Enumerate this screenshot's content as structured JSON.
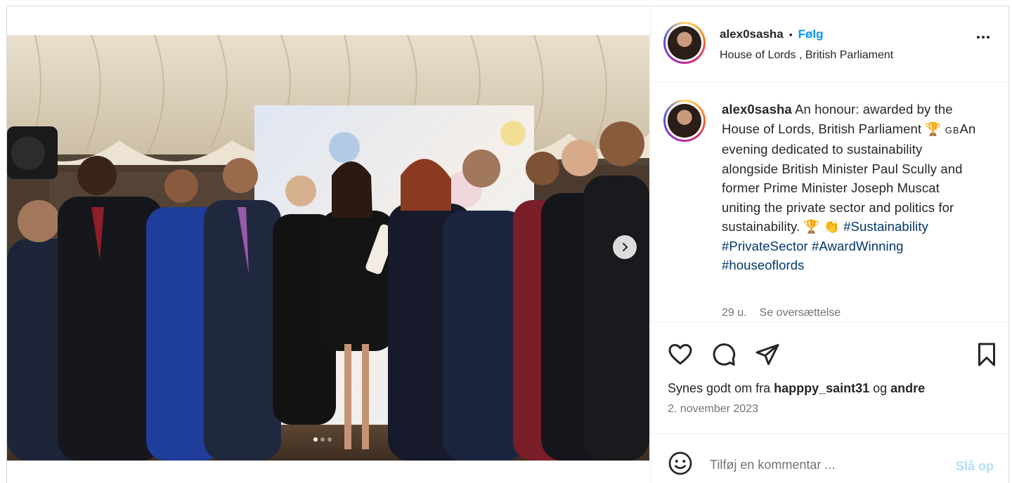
{
  "post": {
    "username": "alex0sasha",
    "follow_label": "Følg",
    "separator": "•",
    "location": "House of Lords , British Parliament",
    "caption_parts": {
      "text1": "An honour: awarded by the House of Lords, British Parliament 🏆 ",
      "flag": "GB",
      "text2": "An evening dedicated to sustainability alongside British Minister Paul Scully and former Prime Minister Joseph Muscat uniting the private sector and politics for sustainability. 🏆 👏 ",
      "hashtags": [
        "#Sustainability",
        "#PrivateSector",
        "#AwardWinning",
        "#houseoflords"
      ]
    },
    "time_ago": "29 u.",
    "translate_label": "Se oversættelse",
    "likes_prefix": "Synes godt om fra ",
    "likes_user": "happpy_saint31",
    "likes_middle": " og ",
    "likes_others": "andre",
    "date": "2. november 2023",
    "comment_placeholder": "Tilføj en kommentar ...",
    "post_label": "Slå op"
  },
  "carousel": {
    "total": 3,
    "active_index": 0
  },
  "icons": {
    "like": "heart-icon",
    "comment": "comment-icon",
    "share": "share-icon",
    "save": "bookmark-icon",
    "emoji": "emoji-icon",
    "next": "chevron-right-icon",
    "more": "more-icon"
  },
  "colors": {
    "accent": "#0095f6",
    "hashtag": "#00376b",
    "muted": "#737373",
    "post_disabled": "#b2dffc"
  }
}
